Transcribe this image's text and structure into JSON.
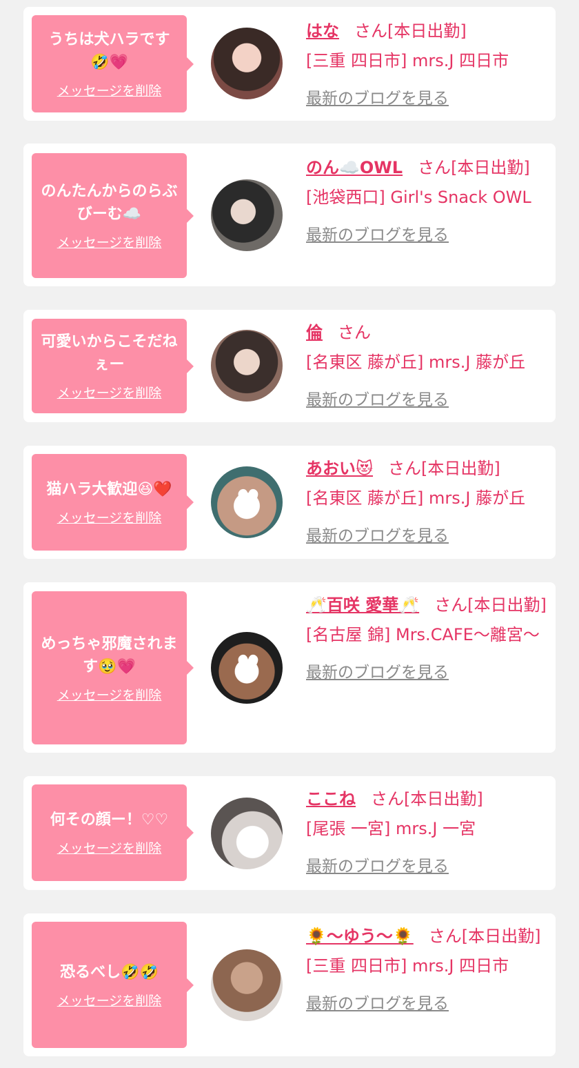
{
  "delete_label": "メッセージを削除",
  "blog_label": "最新のブログを見る",
  "san_label": "さん",
  "entries": [
    {
      "message": "うちは犬ハラです🤣💗",
      "name": "はな",
      "status": "[本日出勤]",
      "location": "[三重 四日市] mrs.J 四日市"
    },
    {
      "message": "のんたんからのらぶびーむ☁️",
      "name": "のん☁️OWL",
      "status": "[本日出勤]",
      "location": "[池袋西口] Girl's Snack OWL"
    },
    {
      "message": "可愛いからこそだねぇー",
      "name": "倫",
      "status": "",
      "location": "[名東区 藤が丘] mrs.J 藤が丘"
    },
    {
      "message": "猫ハラ大歓迎😆❤️",
      "name": "あおい😻",
      "status": "[本日出勤]",
      "location": "[名東区 藤が丘] mrs.J 藤が丘"
    },
    {
      "message": "めっちゃ邪魔されます🥹💗",
      "name": "🥂百咲 愛華🥂",
      "status": "[本日出勤]",
      "location": "[名古屋 錦] Mrs.CAFE〜離宮〜"
    },
    {
      "message": "何その顔ー！♡♡",
      "name": "ここね",
      "status": "[本日出勤]",
      "location": "[尾張 一宮] mrs.J 一宮"
    },
    {
      "message": "恐るべし🤣🤣",
      "name": "🌻〜ゆう〜🌻",
      "status": "[本日出勤]",
      "location": "[三重 四日市] mrs.J 四日市"
    }
  ]
}
